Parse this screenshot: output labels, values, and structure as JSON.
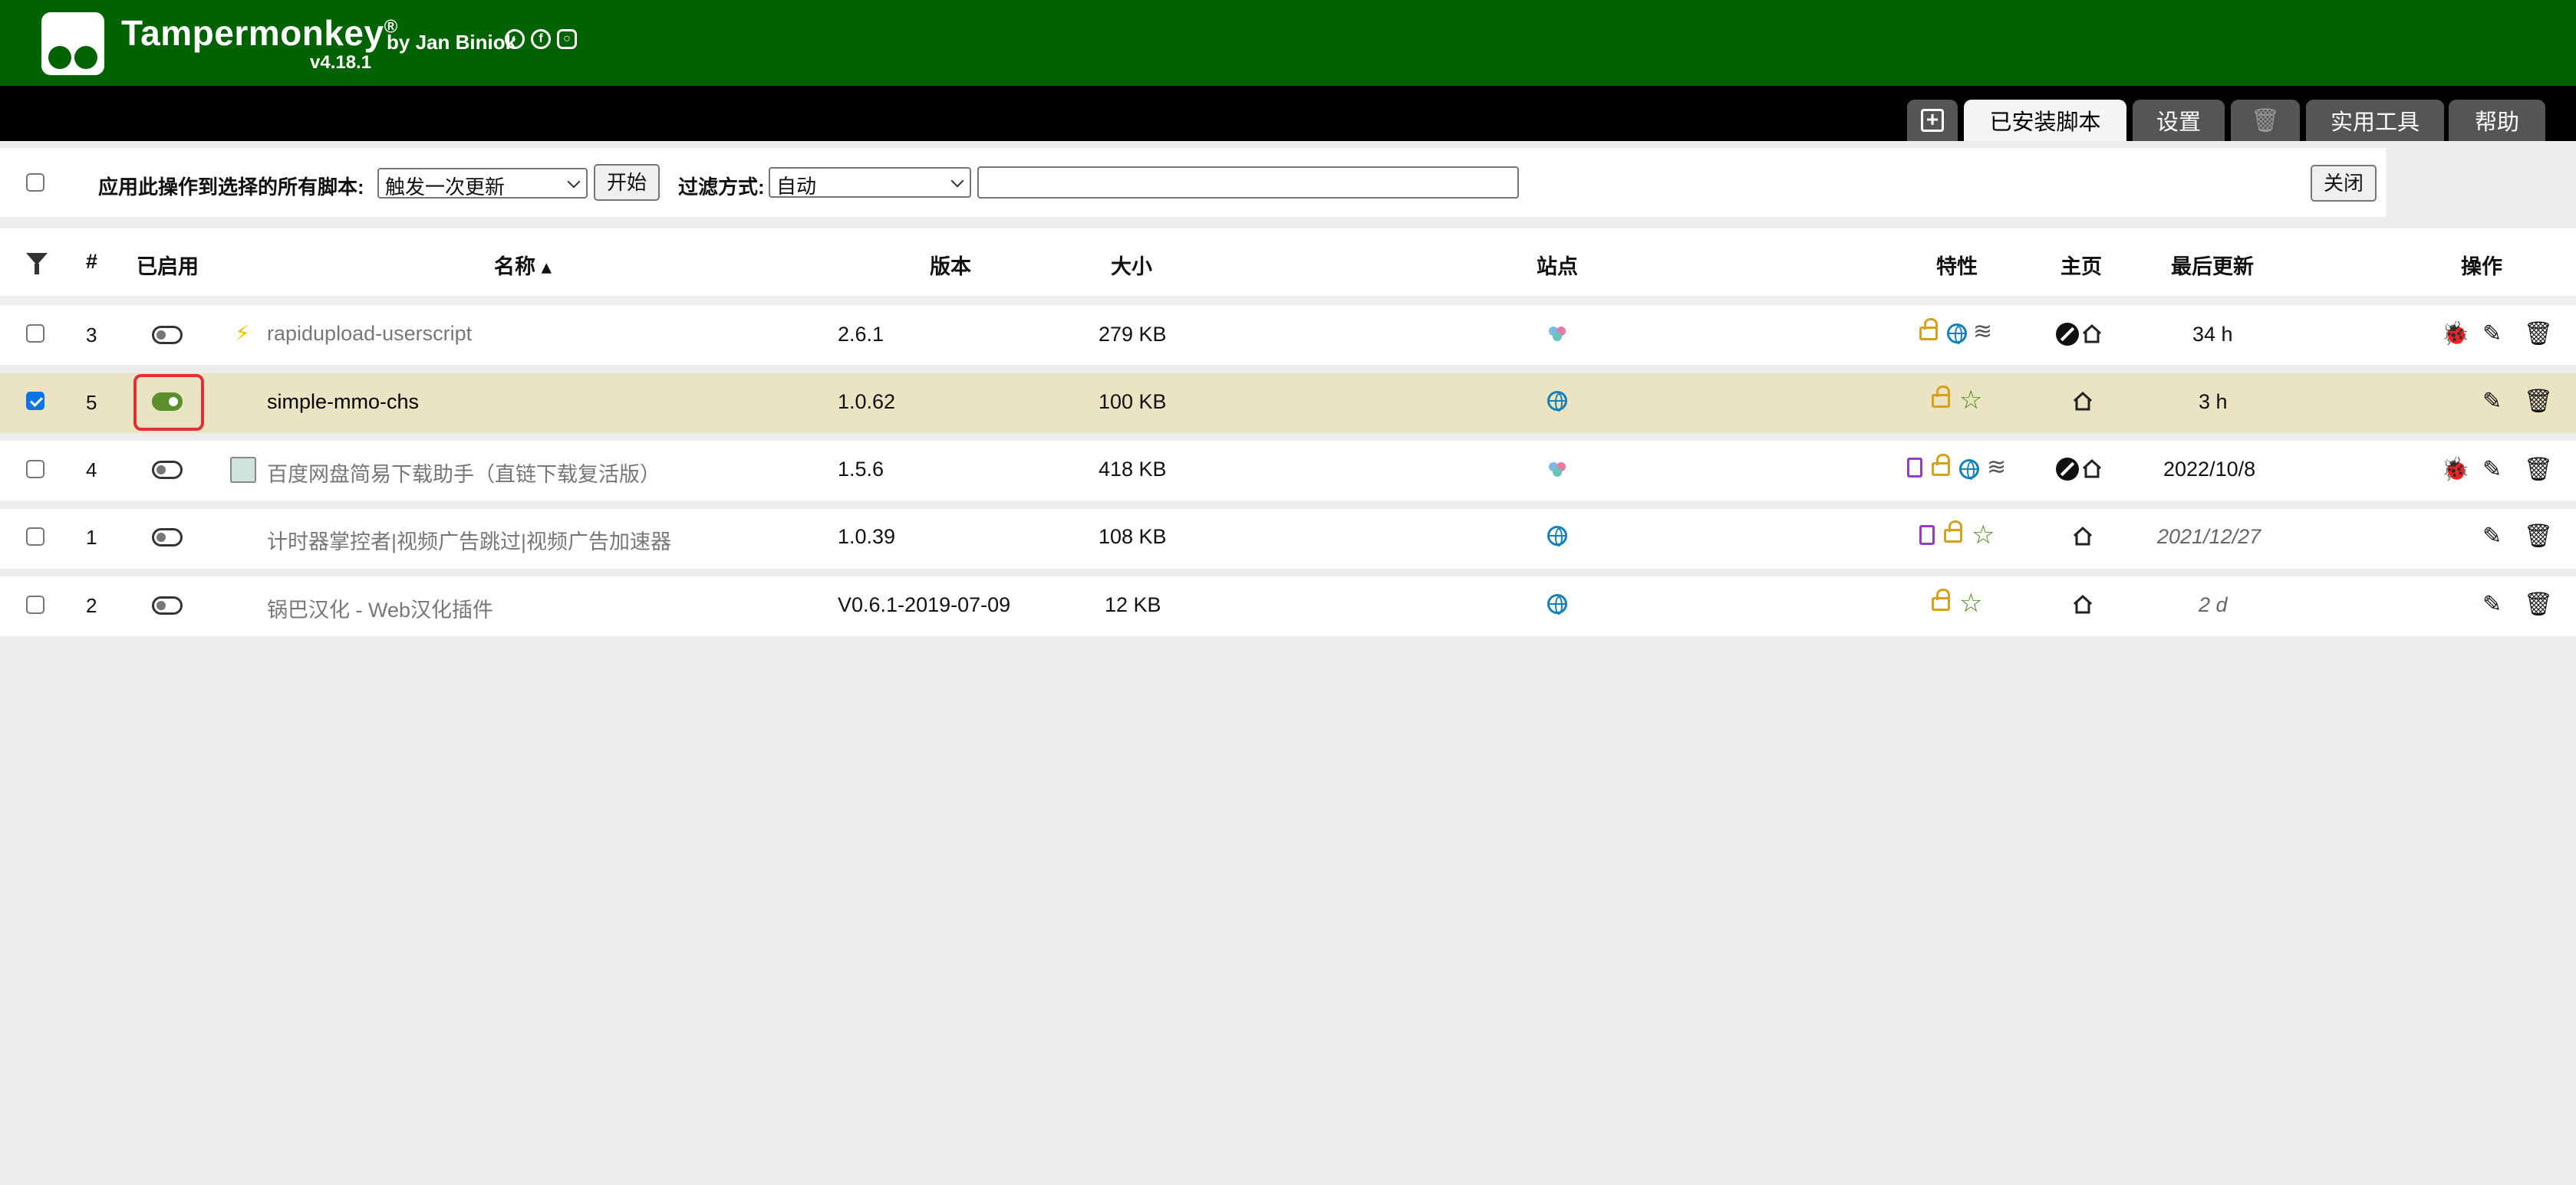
{
  "app": {
    "title": "Tampermonkey",
    "registered": "®",
    "by": "by Jan Biniok",
    "version": "v4.18.1"
  },
  "tabs": [
    {
      "label": "+",
      "icon": "add-icon"
    },
    {
      "label": "已安装脚本",
      "active": true
    },
    {
      "label": "设置"
    },
    {
      "label": "🗑",
      "icon": "trash-icon"
    },
    {
      "label": "实用工具"
    },
    {
      "label": "帮助"
    }
  ],
  "actionbar": {
    "apply_label": "应用此操作到选择的所有脚本:",
    "action_select": "触发一次更新",
    "start_button": "开始",
    "filter_label": "过滤方式:",
    "filter_select": "自动",
    "filter_input": "",
    "close_button": "关闭"
  },
  "columns": {
    "num": "#",
    "enabled": "已启用",
    "name": "名称 ▴",
    "version": "版本",
    "size": "大小",
    "sites": "站点",
    "features": "特性",
    "homepage": "主页",
    "updated": "最后更新",
    "actions": "操作"
  },
  "rows": [
    {
      "num": "3",
      "enabled": false,
      "selected": false,
      "name": "rapidupload-userscript",
      "version": "2.6.1",
      "size": "279 KB",
      "updated": "34 h",
      "updated_italic": false
    },
    {
      "num": "5",
      "enabled": true,
      "selected": true,
      "name": "simple-mmo-chs",
      "version": "1.0.62",
      "size": "100 KB",
      "updated": "3 h",
      "updated_italic": false
    },
    {
      "num": "4",
      "enabled": false,
      "selected": false,
      "name": "百度网盘简易下载助手（直链下载复活版）",
      "version": "1.5.6",
      "size": "418 KB",
      "updated": "2022/10/8",
      "updated_italic": false
    },
    {
      "num": "1",
      "enabled": false,
      "selected": false,
      "name": "计时器掌控者|视频广告跳过|视频广告加速器",
      "version": "1.0.39",
      "size": "108 KB",
      "updated": "2021/12/27",
      "updated_italic": true
    },
    {
      "num": "2",
      "enabled": false,
      "selected": false,
      "name": "锅巴汉化 - Web汉化插件",
      "version": "V0.6.1-2019-07-09",
      "size": "12 KB",
      "updated": "2 d",
      "updated_italic": true
    }
  ],
  "colors": {
    "header_green": "#006300",
    "selected_row": "#ebe4c3",
    "toggle_on": "#5b8f2c",
    "highlight": "#e0303a"
  }
}
